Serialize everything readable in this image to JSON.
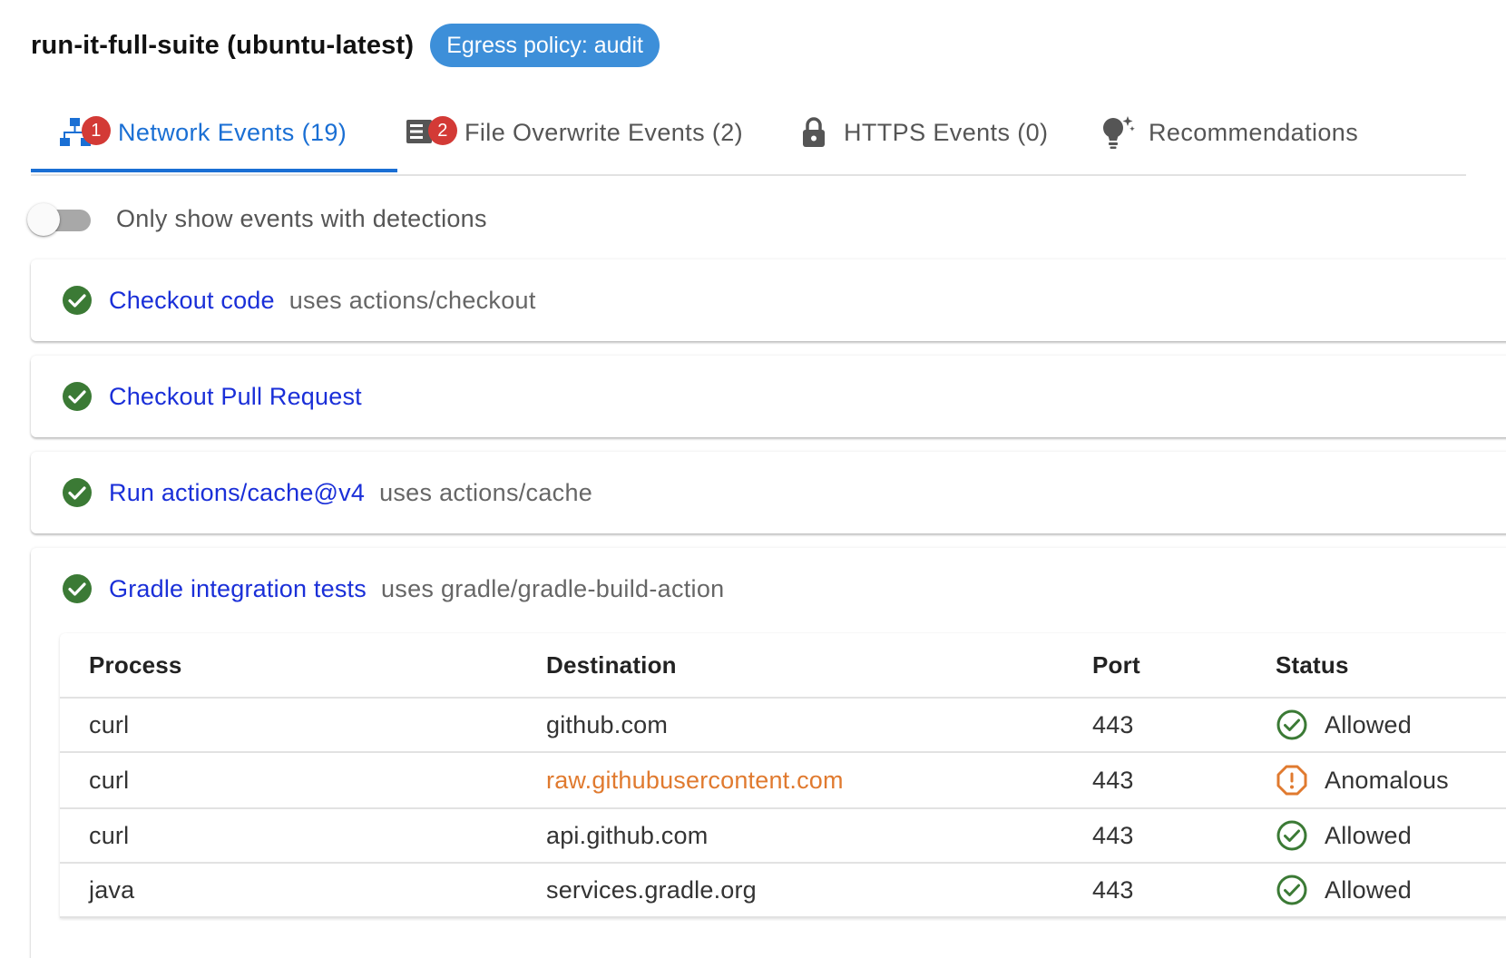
{
  "header": {
    "job_title": "run-it-full-suite (ubuntu-latest)",
    "policy_badge": "Egress policy: audit"
  },
  "tabs": [
    {
      "label": "Network Events (19)",
      "badge": "1",
      "icon": "network-icon",
      "active": true
    },
    {
      "label": "File Overwrite Events (2)",
      "badge": "2",
      "icon": "file-list-icon",
      "active": false
    },
    {
      "label": "HTTPS Events (0)",
      "icon": "lock-icon",
      "active": false
    },
    {
      "label": "Recommendations",
      "icon": "lightbulb-icon",
      "active": false
    }
  ],
  "filter": {
    "toggle_label": "Only show events with detections",
    "enabled": false
  },
  "steps": [
    {
      "name": "Checkout code",
      "uses": "uses actions/checkout",
      "status_icon": "check-circle-icon"
    },
    {
      "name": "Checkout Pull Request",
      "uses": "",
      "status_icon": "check-circle-icon"
    },
    {
      "name": "Run actions/cache@v4",
      "uses": "uses actions/cache",
      "status_icon": "check-circle-icon"
    },
    {
      "name": "Gradle integration tests",
      "uses": "uses gradle/gradle-build-action",
      "status_icon": "check-circle-icon",
      "expanded": true
    }
  ],
  "table": {
    "columns": [
      "Process",
      "Destination",
      "Port",
      "Status"
    ],
    "rows": [
      {
        "process": "curl",
        "destination": "github.com",
        "port": "443",
        "status": "Allowed"
      },
      {
        "process": "curl",
        "destination": "raw.githubusercontent.com",
        "port": "443",
        "status": "Anomalous"
      },
      {
        "process": "curl",
        "destination": "api.github.com",
        "port": "443",
        "status": "Allowed"
      },
      {
        "process": "java",
        "destination": "services.gradle.org",
        "port": "443",
        "status": "Allowed"
      }
    ]
  },
  "colors": {
    "accent_blue": "#1a6fd4",
    "link_blue": "#1a2fd8",
    "badge_blue": "#3d8fd9",
    "badge_red": "#d33a36",
    "success_green": "#3b7a35",
    "anomalous_orange": "#e07a2f"
  }
}
